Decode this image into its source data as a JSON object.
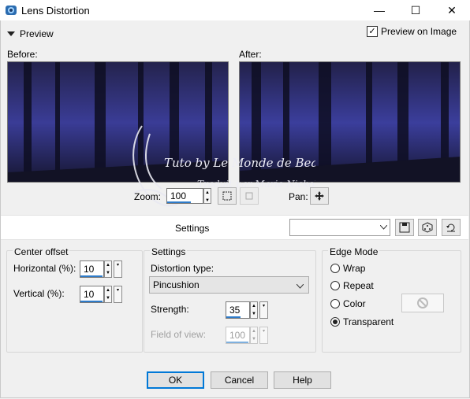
{
  "window": {
    "title": "Lens Distortion",
    "minimize": "—",
    "maximize": "☐",
    "close": "✕"
  },
  "preview": {
    "toggle_label": "Preview",
    "preview_on_image_label": "Preview on Image",
    "preview_on_image_checked": true
  },
  "before_label": "Before:",
  "after_label": "After:",
  "zoom": {
    "label": "Zoom:",
    "value": "100"
  },
  "pan_label": "Pan:",
  "settings_bar": {
    "label": "Settings",
    "preset_value": ""
  },
  "center_offset": {
    "title": "Center offset",
    "horizontal_label": "Horizontal (%):",
    "horizontal_value": "10",
    "vertical_label": "Vertical (%):",
    "vertical_value": "10"
  },
  "settings": {
    "title": "Settings",
    "distortion_type_label": "Distortion type:",
    "distortion_type_value": "Pincushion",
    "strength_label": "Strength:",
    "strength_value": "35",
    "fov_label": "Field of view:",
    "fov_value": "100"
  },
  "edge_mode": {
    "title": "Edge Mode",
    "options": [
      "Wrap",
      "Repeat",
      "Color",
      "Transparent"
    ],
    "selected": "Transparent"
  },
  "buttons": {
    "ok": "OK",
    "cancel": "Cancel",
    "help": "Help"
  },
  "watermark": {
    "line1": "Tuto by Le Monde de Bea",
    "line2": "Traduit par Marie Nickol"
  },
  "colors": {
    "accent": "#0078d7",
    "spin_underline": "#2e7bc9",
    "preview_dark": "#1b1a3a",
    "preview_mid": "#3b3d9a"
  }
}
